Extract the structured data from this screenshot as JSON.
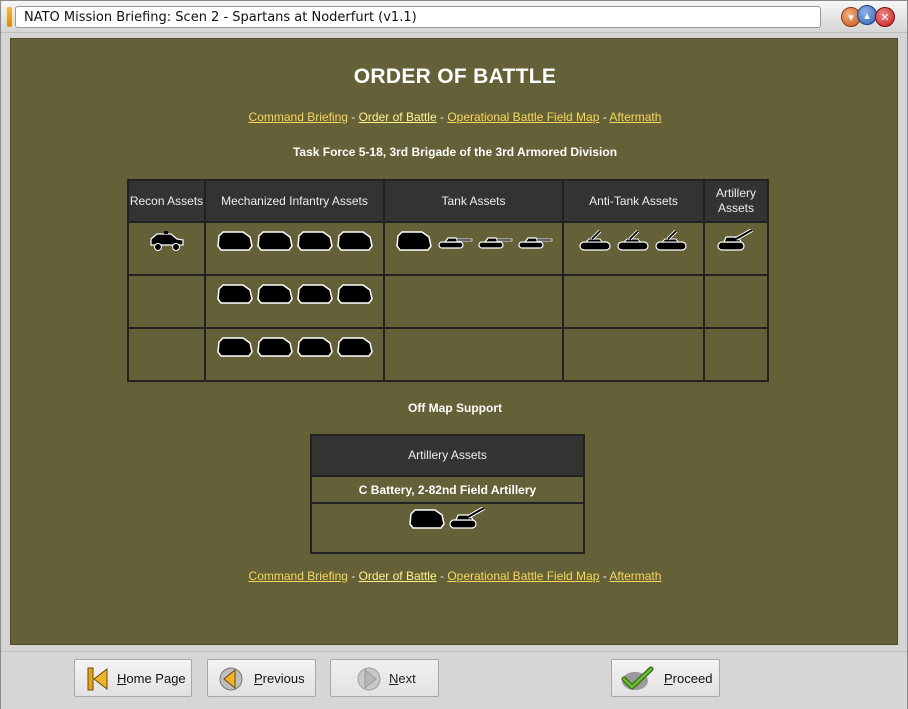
{
  "window": {
    "title": "NATO Mission Briefing: Scen 2 - Spartans at Noderfurt (v1.1)"
  },
  "page": {
    "heading": "ORDER OF BATTLE",
    "separator": " - ",
    "nav": [
      {
        "label": "Command Briefing",
        "current": false
      },
      {
        "label": "Order of Battle",
        "current": true
      },
      {
        "label": "Operational Battle Field Map",
        "current": false
      },
      {
        "label": "Aftermath",
        "current": false
      }
    ],
    "task_force": "Task Force 5-18, 3rd Brigade of the 3rd Armored Division",
    "oob_table": {
      "columns": [
        "Recon Assets",
        "Mechanized Infantry Assets",
        "Tank Assets",
        "Anti-Tank Assets",
        "Artillery Assets"
      ],
      "rows": [
        [
          [
            "recon-vehicle-icon"
          ],
          [
            "apc-icon",
            "apc-icon",
            "apc-icon",
            "apc-icon"
          ],
          [
            "apc-icon",
            "tank-icon",
            "tank-icon",
            "tank-icon"
          ],
          [
            "atgm-vehicle-icon",
            "atgm-vehicle-icon",
            "atgm-vehicle-icon"
          ],
          [
            "sp-artillery-icon"
          ]
        ],
        [
          [],
          [
            "apc-icon",
            "apc-icon",
            "apc-icon",
            "apc-icon"
          ],
          [],
          [],
          []
        ],
        [
          [],
          [
            "apc-icon",
            "apc-icon",
            "apc-icon",
            "apc-icon"
          ],
          [],
          [],
          []
        ]
      ]
    },
    "off_map_support": {
      "heading": "Off Map Support",
      "column": "Artillery Assets",
      "unit_name": "C Battery, 2-82nd Field Artillery",
      "units": [
        "apc-icon",
        "sp-artillery-icon"
      ]
    }
  },
  "buttons": {
    "home": {
      "label_ul": "H",
      "label_rest": "ome Page",
      "icon": "home-icon"
    },
    "previous": {
      "label_ul": "P",
      "label_rest": "revious",
      "icon": "previous-arrow-icon"
    },
    "next": {
      "label_ul": "N",
      "label_rest": "ext",
      "icon": "next-arrow-icon",
      "enabled": false
    },
    "proceed": {
      "label_ul": "P",
      "label_rest": "roceed",
      "icon": "checkmark-icon"
    }
  },
  "colors": {
    "background": "#646037",
    "link": "#f7d75c",
    "link_current": "#fff38e",
    "header_cell": "#333333"
  }
}
